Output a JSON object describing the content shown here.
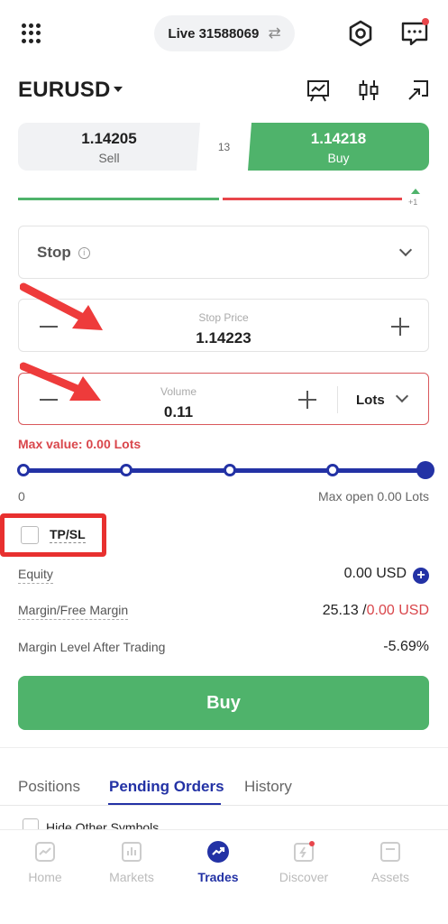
{
  "header": {
    "account_label": "Live 31588069",
    "icons": [
      "grid-menu-icon",
      "swap-icon",
      "settings-hexagon-icon",
      "chat-icon"
    ]
  },
  "symbol": {
    "name": "EURUSD",
    "tools": [
      "chart-icon",
      "candlestick-icon",
      "cast-icon"
    ]
  },
  "quote": {
    "sell_price": "1.14205",
    "sell_label": "Sell",
    "spread": "13",
    "buy_price": "1.14218",
    "buy_label": "Buy",
    "change_label": "+1"
  },
  "order": {
    "type_label": "Stop",
    "stop_price_caption": "Stop Price",
    "stop_price_value": "1.14223",
    "volume_caption": "Volume",
    "volume_value": "0.11",
    "unit_label": "Lots",
    "max_value_text": "Max value: 0.00 Lots",
    "slider_min": "0",
    "slider_max": "Max open 0.00 Lots",
    "slider_level": 1.0,
    "tpsl_label": "TP/SL",
    "tpsl_checked": false
  },
  "account_info": {
    "equity_label": "Equity",
    "equity_value": "0.00 USD",
    "margin_label": "Margin/Free Margin",
    "margin_value": "25.13 /",
    "free_margin_value": "0.00 USD",
    "margin_level_label": "Margin Level After Trading",
    "margin_level_value": "-5.69%"
  },
  "buy_button_label": "Buy",
  "tabs": {
    "items": [
      "Positions",
      "Pending Orders",
      "History"
    ],
    "active": "Pending Orders"
  },
  "hide_other_symbols_label": "Hide Other Symbols",
  "bottom_nav": {
    "items": [
      "Home",
      "Markets",
      "Trades",
      "Discover",
      "Assets"
    ],
    "active": "Trades"
  },
  "colors": {
    "buy_green": "#4fb36b",
    "sell_red": "#e8464b",
    "primary_blue": "#2332a5",
    "annotation_red": "#e8302f"
  }
}
